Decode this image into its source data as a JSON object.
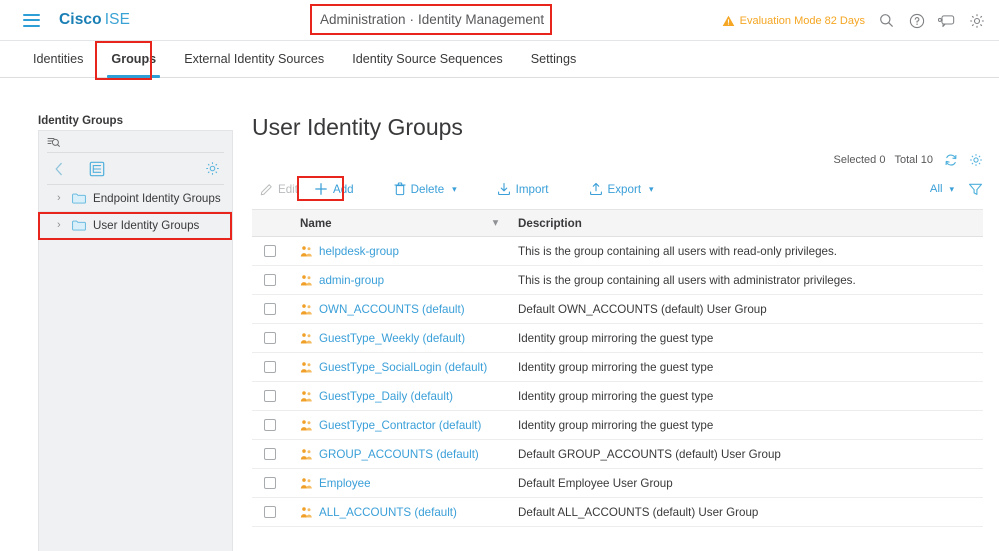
{
  "header": {
    "menu_icon": "hamburger-menu-icon",
    "brand_primary": "Cisco",
    "brand_secondary": "ISE",
    "context_left": "Administration",
    "context_separator": "·",
    "context_right": "Identity Management",
    "evaluation_text": "Evaluation Mode 82 Days",
    "evaluation_color": "#f5a623",
    "icons": [
      "search-icon",
      "help-icon",
      "feedback-icon",
      "settings-gear-icon"
    ]
  },
  "tabs": [
    {
      "label": "Identities",
      "active": false
    },
    {
      "label": "Groups",
      "active": true
    },
    {
      "label": "External Identity Sources",
      "active": false
    },
    {
      "label": "Identity Source Sequences",
      "active": false
    },
    {
      "label": "Settings",
      "active": false
    }
  ],
  "sidebar": {
    "title": "Identity Groups",
    "search_placeholder": "",
    "search_value": "",
    "search_icon": "filter-search-icon",
    "tools": [
      "back-chevron-icon",
      "tree-view-icon",
      "settings-gear-icon"
    ],
    "tree": [
      {
        "label": "Endpoint Identity Groups",
        "expanded": false
      },
      {
        "label": "User Identity Groups",
        "expanded": false
      }
    ]
  },
  "main": {
    "page_title": "User Identity Groups",
    "selected_label": "Selected 0",
    "total_label": "Total 10",
    "refresh_icon": "refresh-icon",
    "settings_icon": "settings-gear-icon",
    "filter_scope": "All",
    "filter_icon": "filter-funnel-icon",
    "toolbar": {
      "edit": "Edit",
      "add": "Add",
      "delete": "Delete",
      "import": "Import",
      "export": "Export"
    },
    "table": {
      "columns": [
        "Name",
        "Description"
      ],
      "rows": [
        {
          "name": "helpdesk-group",
          "description": "This is the group containing all users with read-only privileges."
        },
        {
          "name": "admin-group",
          "description": "This is the group containing all users with administrator privileges."
        },
        {
          "name": "OWN_ACCOUNTS (default)",
          "description": "Default OWN_ACCOUNTS (default) User Group"
        },
        {
          "name": "GuestType_Weekly (default)",
          "description": "Identity group mirroring the guest type"
        },
        {
          "name": "GuestType_SocialLogin (default)",
          "description": "Identity group mirroring the guest type"
        },
        {
          "name": "GuestType_Daily (default)",
          "description": "Identity group mirroring the guest type"
        },
        {
          "name": "GuestType_Contractor (default)",
          "description": "Identity group mirroring the guest type"
        },
        {
          "name": "GROUP_ACCOUNTS (default)",
          "description": "Default GROUP_ACCOUNTS (default) User Group"
        },
        {
          "name": "Employee",
          "description": "Default Employee User Group"
        },
        {
          "name": "ALL_ACCOUNTS (default)",
          "description": "Default ALL_ACCOUNTS (default) User Group"
        }
      ]
    }
  },
  "colors": {
    "accent_blue": "#3a9fd8",
    "brand_blue": "#1a7fb5",
    "annotation_red": "#e8251c",
    "group_icon_orange": "#f0a028",
    "folder_icon_blue": "#6fc8ea"
  }
}
